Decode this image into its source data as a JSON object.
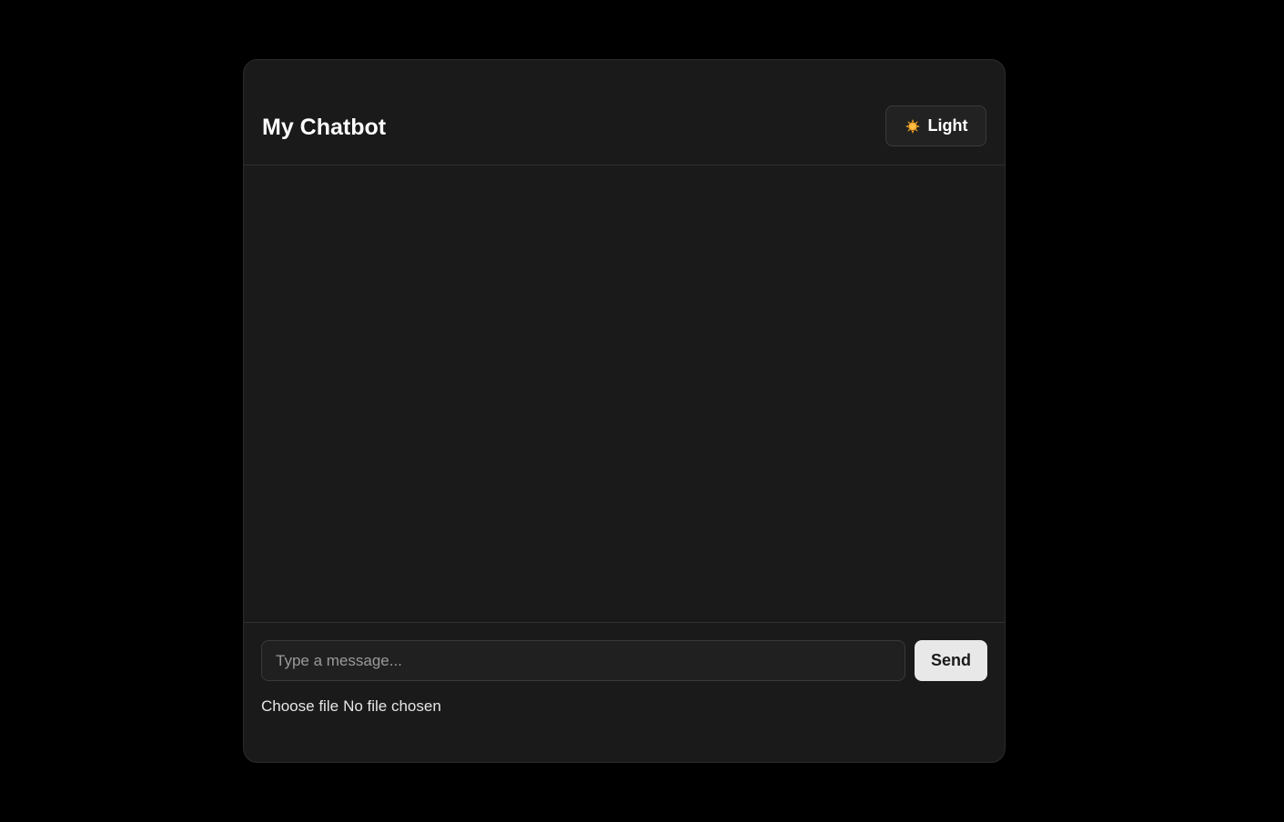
{
  "header": {
    "title": "My Chatbot",
    "theme_toggle": {
      "icon": "sun-icon",
      "label": "Light"
    }
  },
  "composer": {
    "input_placeholder": "Type a message...",
    "input_value": "",
    "send_label": "Send"
  },
  "file_upload": {
    "button_label": "Choose file",
    "status": "No file chosen"
  },
  "colors": {
    "page_background": "#000000",
    "panel_background": "#1a1a1a",
    "send_button": "#e8e8e8",
    "sun_icon": "#f5a623"
  }
}
